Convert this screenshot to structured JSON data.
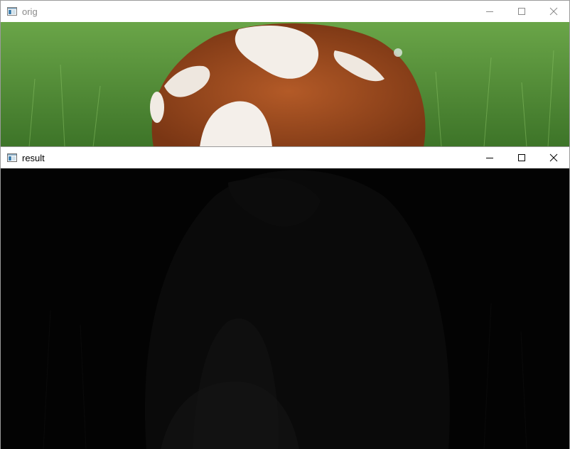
{
  "windows": {
    "orig": {
      "title": "orig",
      "icon": "app-window-icon",
      "controls": [
        "minimize-icon",
        "maximize-icon",
        "close-icon"
      ],
      "image": "dog-on-grass-photo"
    },
    "result": {
      "title": "result",
      "icon": "app-window-icon",
      "controls": [
        "minimize-icon",
        "maximize-icon",
        "close-icon"
      ],
      "image": "dark-processed-dog-image"
    }
  },
  "colors": {
    "grass": "#4f8a34",
    "fur_brown": "#9b4a1d",
    "fur_white": "#f3eee8",
    "result_bg": "#030303"
  }
}
